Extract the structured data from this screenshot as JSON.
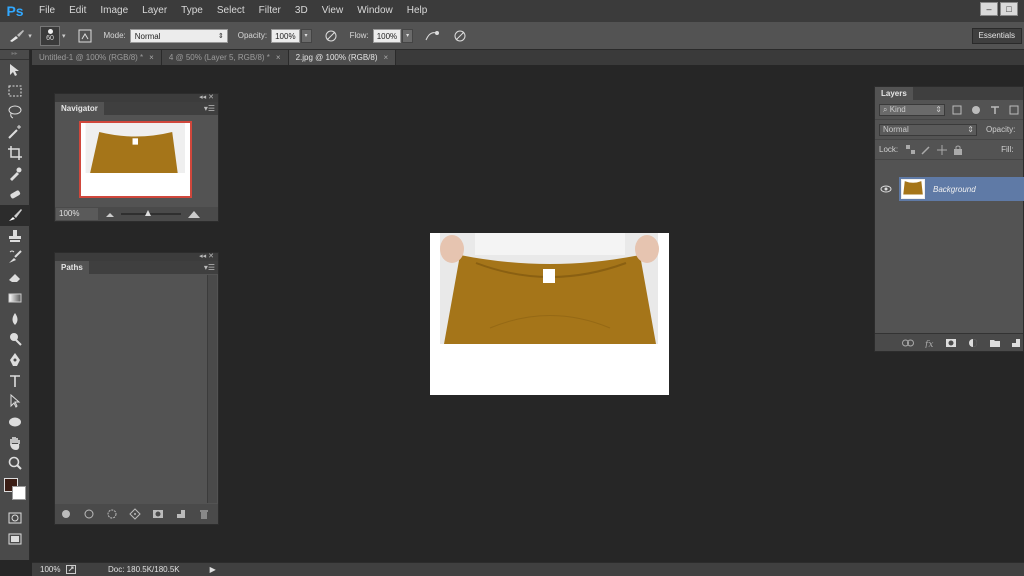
{
  "app": {
    "logo": "Ps"
  },
  "menu": [
    "File",
    "Edit",
    "Image",
    "Layer",
    "Type",
    "Select",
    "Filter",
    "3D",
    "View",
    "Window",
    "Help"
  ],
  "window_controls": [
    "–",
    "□"
  ],
  "options_bar": {
    "brush_size": "60",
    "mode_label": "Mode:",
    "mode_value": "Normal",
    "opacity_label": "Opacity:",
    "opacity_value": "100%",
    "flow_label": "Flow:",
    "flow_value": "100%",
    "workspace": "Essentials"
  },
  "doc_tabs": [
    {
      "label": "Untitled-1 @ 100% (RGB/8) *",
      "active": false
    },
    {
      "label": "4 @ 50% (Layer 5, RGB/8) *",
      "active": false
    },
    {
      "label": "2.jpg @ 100% (RGB/8)",
      "active": true
    }
  ],
  "tools": [
    "move-icon",
    "marquee-icon",
    "lasso-icon",
    "magic-wand-icon",
    "crop-icon",
    "eyedropper-icon",
    "healing-icon",
    "brush-icon",
    "stamp-icon",
    "history-brush-icon",
    "eraser-icon",
    "gradient-icon",
    "blur-icon",
    "dodge-icon",
    "pen-icon",
    "type-icon",
    "path-select-icon",
    "ellipse-icon",
    "hand-icon",
    "zoom-icon"
  ],
  "colors": {
    "foreground": "#3a1d14",
    "background": "#ffffff",
    "garment": "#a57519",
    "accent": "#d0473c"
  },
  "navigator": {
    "title": "Navigator",
    "zoom": "100%"
  },
  "paths": {
    "title": "Paths"
  },
  "layers": {
    "title": "Layers",
    "kind_filter": "Kind",
    "blend_mode": "Normal",
    "opacity_label": "Opacity:",
    "lock_label": "Lock:",
    "fill_label": "Fill:",
    "items": [
      {
        "name": "Background"
      }
    ]
  },
  "status": {
    "zoom": "100%",
    "doc_info": "Doc: 180.5K/180.5K"
  }
}
